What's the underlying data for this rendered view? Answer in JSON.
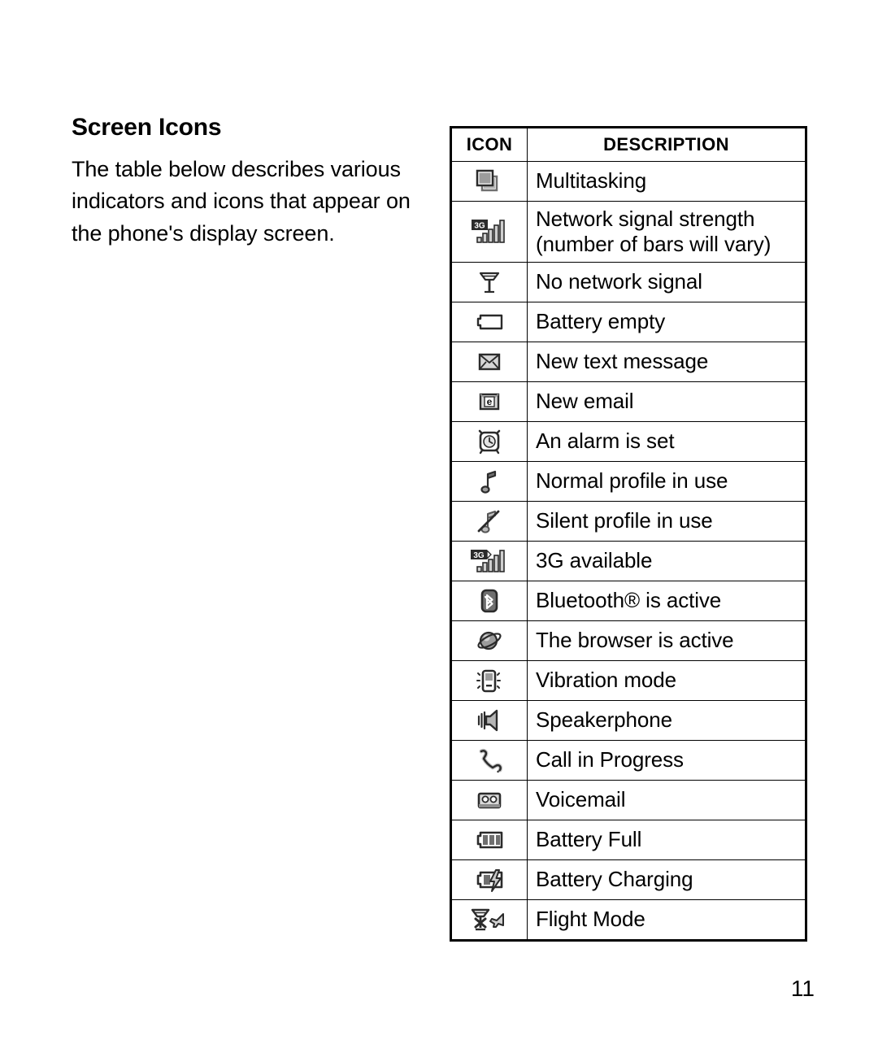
{
  "document": {
    "page_number": "11"
  },
  "section": {
    "title": "Screen Icons",
    "intro": "The table below describes various indicators and icons that appear on the phone's display screen."
  },
  "table": {
    "headers": {
      "icon": "ICON",
      "description": "DESCRIPTION"
    },
    "rows": [
      {
        "icon_name": "multitasking-icon",
        "description": "Multitasking"
      },
      {
        "icon_name": "network-signal-strength-icon",
        "description": "Network signal strength (number of bars will vary)"
      },
      {
        "icon_name": "no-network-signal-icon",
        "description": "No network signal"
      },
      {
        "icon_name": "battery-empty-icon",
        "description": "Battery empty"
      },
      {
        "icon_name": "new-text-message-icon",
        "description": "New text message"
      },
      {
        "icon_name": "new-email-icon",
        "description": "New email"
      },
      {
        "icon_name": "alarm-set-icon",
        "description": "An alarm is set"
      },
      {
        "icon_name": "normal-profile-icon",
        "description": "Normal profile in use"
      },
      {
        "icon_name": "silent-profile-icon",
        "description": "Silent profile in use"
      },
      {
        "icon_name": "3g-available-icon",
        "description": "3G available"
      },
      {
        "icon_name": "bluetooth-active-icon",
        "description": "Bluetooth® is active"
      },
      {
        "icon_name": "browser-active-icon",
        "description": "The browser is active"
      },
      {
        "icon_name": "vibration-mode-icon",
        "description": "Vibration mode"
      },
      {
        "icon_name": "speakerphone-icon",
        "description": "Speakerphone"
      },
      {
        "icon_name": "call-in-progress-icon",
        "description": "Call in Progress"
      },
      {
        "icon_name": "voicemail-icon",
        "description": "Voicemail"
      },
      {
        "icon_name": "battery-full-icon",
        "description": "Battery Full"
      },
      {
        "icon_name": "battery-charging-icon",
        "description": "Battery Charging"
      },
      {
        "icon_name": "flight-mode-icon",
        "description": "Flight Mode"
      }
    ]
  },
  "network_signal_lines": {
    "line1": "Network signal strength",
    "line2": "(number of bars will vary)"
  }
}
